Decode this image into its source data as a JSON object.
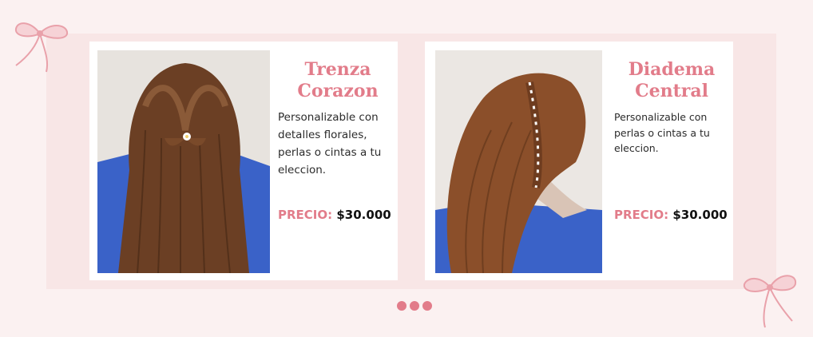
{
  "products": [
    {
      "title_line1": "Trenza",
      "title_line2": "Corazon",
      "description": "Personalizable con detalles florales, perlas o cintas a tu eleccion.",
      "price_label": "PRECIO:",
      "price_value": "$30.000"
    },
    {
      "title_line1": "Diadema",
      "title_line2": "Central",
      "description": "Personalizable con perlas o cintas a tu eleccion.",
      "price_label": "PRECIO:",
      "price_value": "$30.000"
    }
  ],
  "carousel": {
    "dot_count": 3,
    "active_index": 0
  },
  "colors": {
    "accent": "#e27c8a",
    "background": "#fbf1f1",
    "band": "#f8e6e6",
    "card": "#ffffff",
    "hair": "#6b3f24",
    "mannequin_blue": "#3a62c8"
  },
  "icons": {
    "decoration": "ribbon-bow-icon",
    "pager": "dot-icon"
  }
}
